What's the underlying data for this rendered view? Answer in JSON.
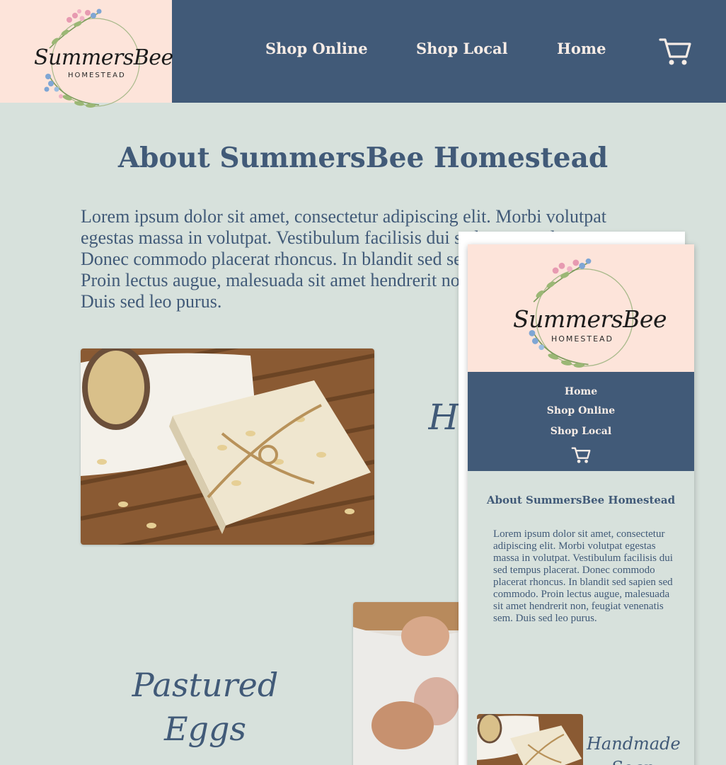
{
  "brand": {
    "name": "SummersBee",
    "tagline": "HOMESTEAD"
  },
  "nav": {
    "shop_online": "Shop Online",
    "shop_local": "Shop Local",
    "home": "Home",
    "cart_icon": "shopping-cart-icon"
  },
  "about": {
    "title": "About SummersBee Homestead",
    "body": "Lorem ipsum dolor sit amet, consectetur adipiscing elit. Morbi volutpat egestas massa in volutpat. Vestibulum facilisis dui sed tempus placerat. Donec commodo placerat rhoncus. In blandit sed sed sapien sed commodo. Proin lectus augue, malesuada sit amet hendrerit non, feugiat venenatis sem. Duis sed leo purus."
  },
  "products": {
    "soap_heading": "Handmade Soap",
    "eggs_heading": "Pastured Eggs"
  },
  "mobile": {
    "nav": {
      "home": "Home",
      "shop_online": "Shop Online",
      "shop_local": "Shop Local"
    },
    "title": "About SummersBee Homestead",
    "body": "Lorem ipsum dolor sit amet, consectetur adipiscing elit. Morbi volutpat egestas massa in volutpat. Vestibulum facilisis dui sed tempus placerat. Donec commodo placerat rhoncus. In blandit sed sapien sed commodo. Proin lectus augue, malesuada sit amet hendrerit non, feugiat venenatis sem. Duis sed leo purus.",
    "soap_heading": "Handmade Soap"
  },
  "colors": {
    "header_bg": "#415a78",
    "page_bg": "#d7e1dc",
    "logo_bg": "#fde4da",
    "nav_text": "#f6ece6",
    "accent_text": "#415a78"
  }
}
